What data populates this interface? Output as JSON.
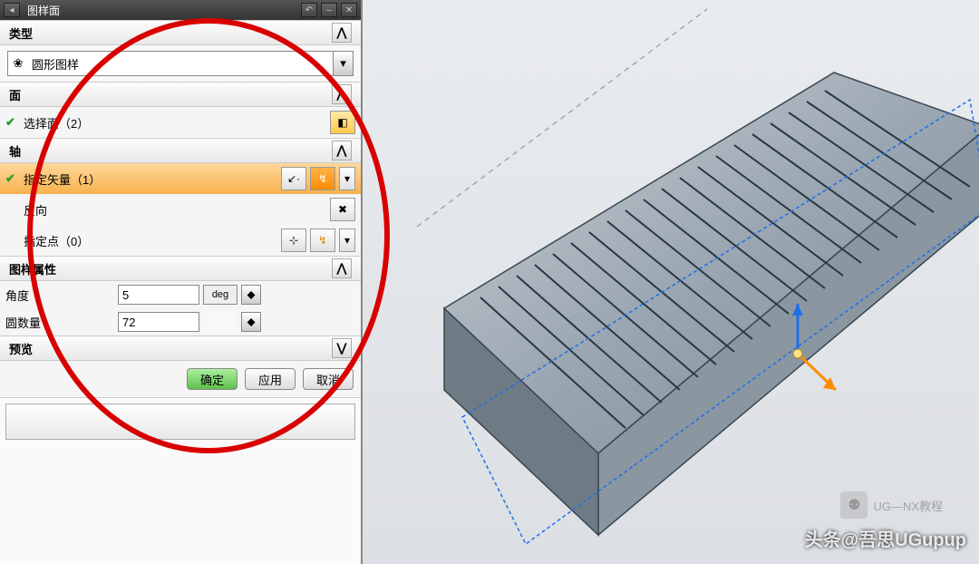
{
  "titlebar": {
    "title": "图样面"
  },
  "sections": {
    "type": {
      "header": "类型",
      "dropdown_icon": "❀",
      "dropdown_value": "圆形图样"
    },
    "face": {
      "header": "面",
      "select_face": "选择面（2）"
    },
    "axis": {
      "header": "轴",
      "vector": "指定矢量（1）",
      "reverse": "反向",
      "point": "指定点（0）"
    },
    "pattern": {
      "header": "图样属性",
      "angle_label": "角度",
      "angle_value": "5",
      "angle_unit": "deg",
      "count_label": "圆数量",
      "count_value": "72"
    },
    "preview": {
      "header": "预览"
    }
  },
  "buttons": {
    "ok": "确定",
    "apply": "应用",
    "cancel": "取消"
  },
  "watermark": {
    "main": "头条@吾思UGupup",
    "sub": "UG—NX教程"
  }
}
